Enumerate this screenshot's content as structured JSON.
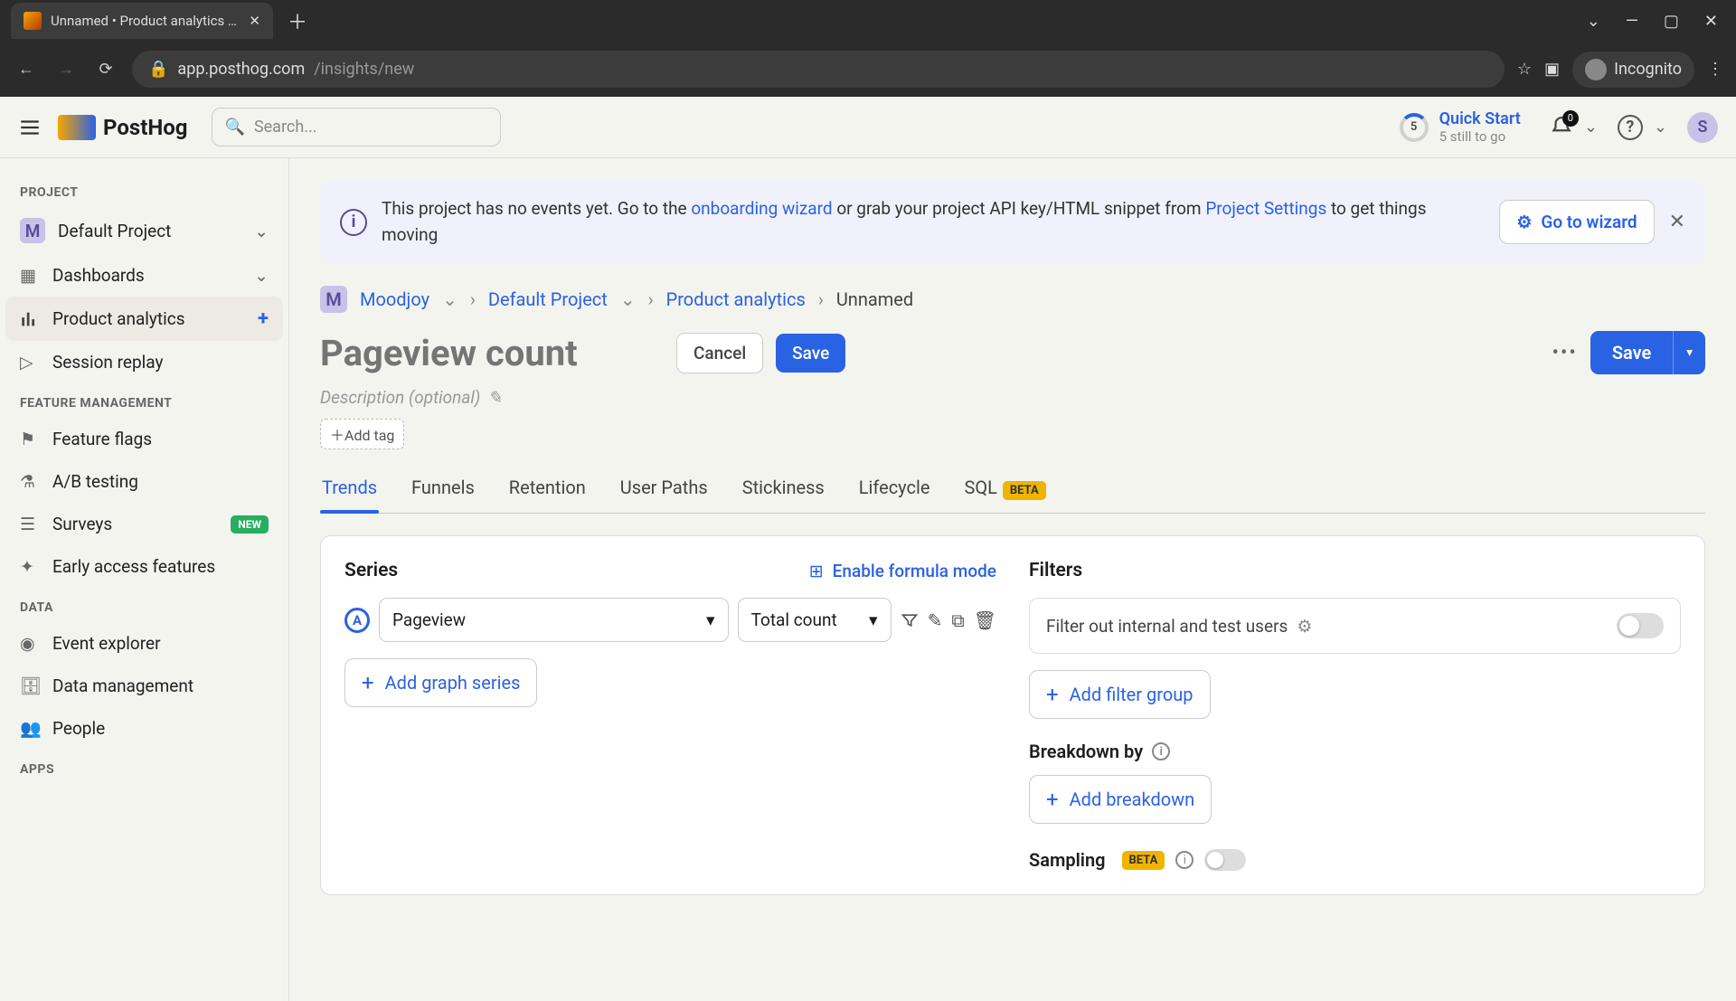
{
  "browser": {
    "tab_title": "Unnamed • Product analytics • P",
    "url_host": "app.posthog.com",
    "url_path": "/insights/new",
    "incognito": "Incognito"
  },
  "topbar": {
    "search_placeholder": "Search...",
    "logo_text": "PostHog",
    "quick_start": "Quick Start",
    "quick_start_sub": "5 still to go",
    "quick_start_num": "5",
    "bell_count": "0",
    "avatar_letter": "S"
  },
  "sidebar": {
    "sections": {
      "project": "PROJECT",
      "feature": "FEATURE MANAGEMENT",
      "data": "DATA",
      "apps": "APPS"
    },
    "project_badge": "M",
    "items": {
      "default_project": "Default Project",
      "dashboards": "Dashboards",
      "product_analytics": "Product analytics",
      "session_replay": "Session replay",
      "feature_flags": "Feature flags",
      "ab_testing": "A/B testing",
      "surveys": "Surveys",
      "surveys_badge": "NEW",
      "early_access": "Early access features",
      "event_explorer": "Event explorer",
      "data_management": "Data management",
      "people": "People"
    }
  },
  "alert": {
    "text_1": "This project has no events yet. Go to the ",
    "link_1": "onboarding wizard",
    "text_2": " or grab your project API key/HTML snippet from ",
    "link_2": "Project Settings",
    "text_3": " to get things moving",
    "button": "Go to wizard"
  },
  "breadcrumbs": {
    "org_badge": "M",
    "org": "Moodjoy",
    "project": "Default Project",
    "section": "Product analytics",
    "current": "Unnamed"
  },
  "title": {
    "placeholder": "Pageview count",
    "cancel": "Cancel",
    "save_inline": "Save",
    "save_main": "Save"
  },
  "desc": {
    "placeholder": "Description (optional)",
    "add_tag": "Add tag"
  },
  "tabs": {
    "trends": "Trends",
    "funnels": "Funnels",
    "retention": "Retention",
    "user_paths": "User Paths",
    "stickiness": "Stickiness",
    "lifecycle": "Lifecycle",
    "sql": "SQL",
    "beta": "BETA"
  },
  "series": {
    "heading": "Series",
    "formula": "Enable formula mode",
    "badge": "A",
    "event": "Pageview",
    "count": "Total count",
    "add": "Add graph series"
  },
  "filters": {
    "heading": "Filters",
    "internal": "Filter out internal and test users",
    "add_filter": "Add filter group",
    "breakdown": "Breakdown by",
    "add_breakdown": "Add breakdown",
    "sampling": "Sampling",
    "beta": "BETA"
  }
}
